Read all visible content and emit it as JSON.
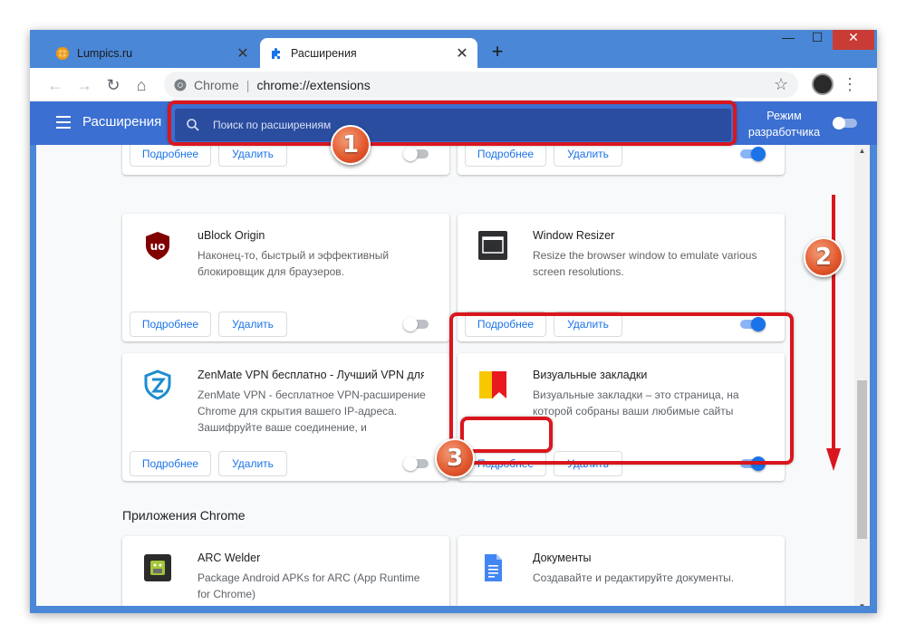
{
  "tabs": [
    {
      "title": "Lumpics.ru",
      "close": "✕"
    },
    {
      "title": "Расширения",
      "close": "✕"
    }
  ],
  "new_tab": "+",
  "window_controls": {
    "minimize": "—",
    "maximize": "☐",
    "close": "✕"
  },
  "address_bar": {
    "site_label": "Chrome",
    "separator": "|",
    "url": "chrome://extensions"
  },
  "header": {
    "title": "Расширения",
    "search_placeholder": "Поиск по расширениям",
    "dev_mode_label": "Режим разработчика",
    "dev_mode_on": false
  },
  "buttons": {
    "details": "Подробнее",
    "remove": "Удалить"
  },
  "extensions": [
    {
      "name": "",
      "description": "",
      "enabled": false
    },
    {
      "name": "",
      "description": "",
      "enabled": true
    },
    {
      "name": "uBlock Origin",
      "description": "Наконец-то, быстрый и эффективный блокировщик для браузеров.",
      "enabled": false,
      "icon": "ublock-shield-icon"
    },
    {
      "name": "Window Resizer",
      "description": "Resize the browser window to emulate various screen resolutions.",
      "enabled": true,
      "icon": "window-resizer-icon"
    },
    {
      "name": "ZenMate VPN бесплатно - Лучший VPN для ...",
      "description": "ZenMate VPN - бесплатное VPN-расширение Chrome для скрытия вашего IP-адреса. Зашифруйте ваше соединение, и",
      "enabled": false,
      "icon": "zenmate-shield-icon"
    },
    {
      "name": "Визуальные закладки",
      "description": "Визуальные закладки – это страница, на которой собраны ваши любимые сайты",
      "enabled": true,
      "icon": "bookmark-flag-icon"
    }
  ],
  "apps_section": {
    "title": "Приложения Chrome",
    "apps": [
      {
        "name": "ARC Welder",
        "description": "Package Android APKs for ARC (App Runtime for Chrome)",
        "icon": "arc-welder-icon"
      },
      {
        "name": "Документы",
        "description": "Создавайте и редактируйте документы.",
        "icon": "docs-icon"
      }
    ]
  },
  "annotations": {
    "badge1": "1",
    "badge2": "2",
    "badge3": "3"
  },
  "colors": {
    "accent_blue": "#1a73e8",
    "header_blue": "#3b6fd1",
    "highlight_red": "#d9161e",
    "badge_orange": "#e2562c"
  }
}
